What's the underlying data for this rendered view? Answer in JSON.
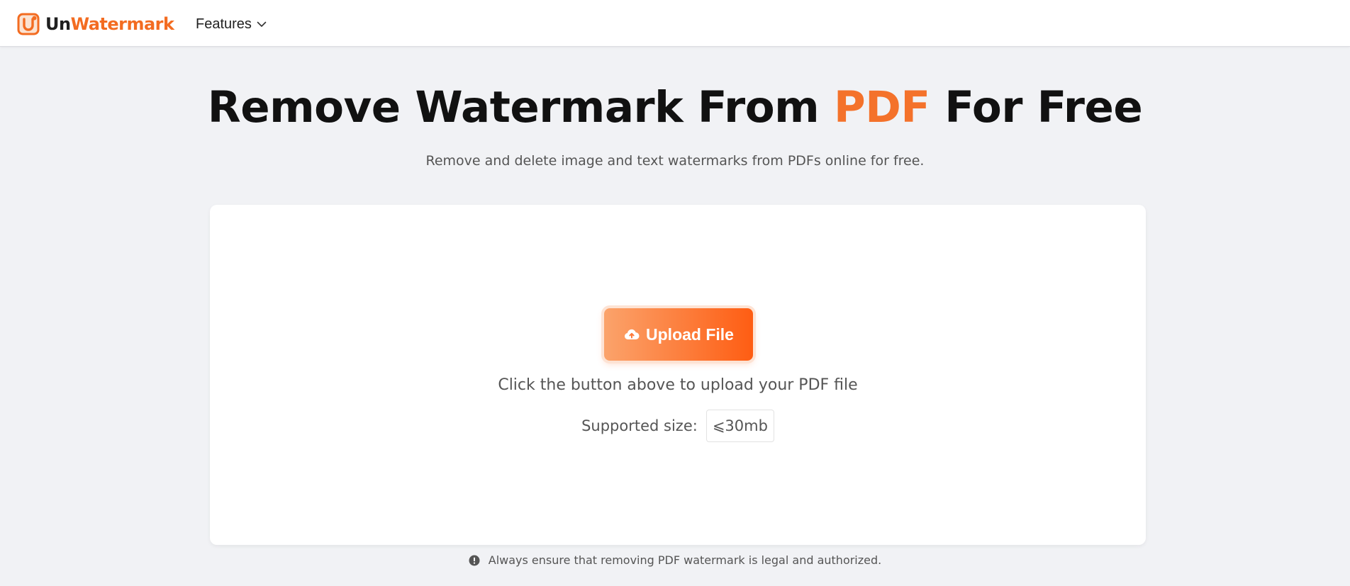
{
  "brand": {
    "name_part1": "Un",
    "name_part2": "Watermark",
    "logo_icon": "unwatermark-logo-icon",
    "accent_color": "#f36c21"
  },
  "nav": {
    "features_label": "Features",
    "features_icon": "chevron-down-icon"
  },
  "hero": {
    "title_before": "Remove Watermark From ",
    "title_accent": "PDF",
    "title_after": " For Free",
    "subtitle": "Remove and delete image and text watermarks from PDFs online for free."
  },
  "upload": {
    "button_label": "Upload File",
    "button_icon": "cloud-upload-icon",
    "hint": "Click the button above to upload your PDF file",
    "size_label": "Supported size:",
    "size_value": "⩽30mb"
  },
  "notice": {
    "icon": "warning-icon",
    "text": "Always ensure that removing PDF watermark is legal and authorized."
  }
}
